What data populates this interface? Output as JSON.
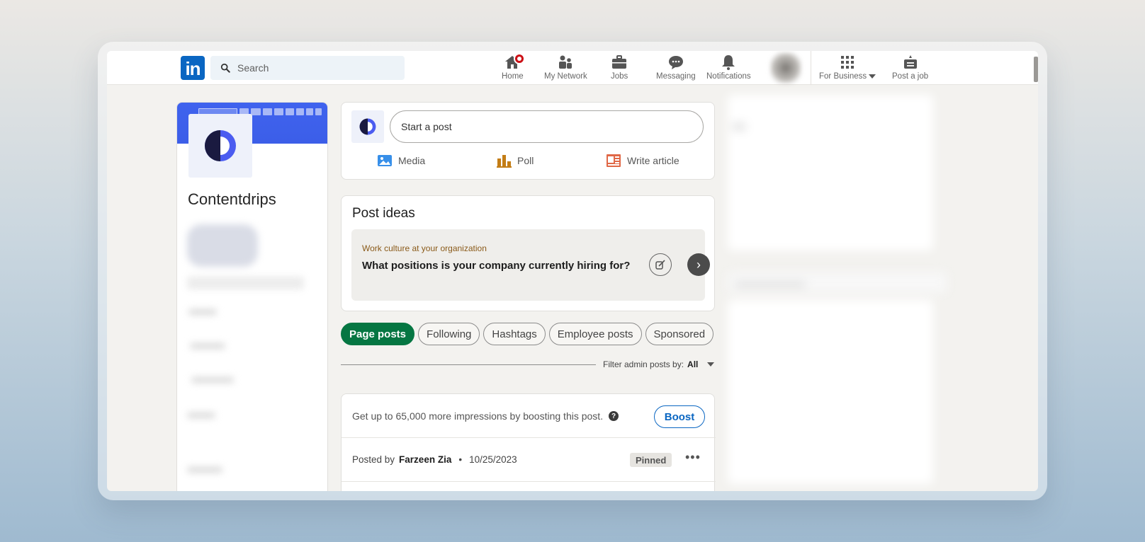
{
  "nav": {
    "search_placeholder": "Search",
    "items": [
      {
        "label": "Home",
        "icon": "home-icon"
      },
      {
        "label": "My Network",
        "icon": "network-icon"
      },
      {
        "label": "Jobs",
        "icon": "briefcase-icon"
      },
      {
        "label": "Messaging",
        "icon": "messaging-icon"
      },
      {
        "label": "Notifications",
        "icon": "bell-icon"
      }
    ],
    "for_business": "For Business",
    "post_job": "Post a job"
  },
  "company": {
    "name": "Contentdrips"
  },
  "composer": {
    "placeholder": "Start a post",
    "actions": {
      "media": "Media",
      "poll": "Poll",
      "article": "Write article"
    }
  },
  "ideas": {
    "title": "Post ideas",
    "tag": "Work culture at your organization",
    "question": "What positions is your company currently hiring for?"
  },
  "tabs": [
    "Page posts",
    "Following",
    "Hashtags",
    "Employee posts",
    "Sponsored"
  ],
  "filter": {
    "label": "Filter admin posts by:",
    "value": "All"
  },
  "post": {
    "boost_text": "Get up to 65,000 more impressions by boosting this post.",
    "boost_button": "Boost",
    "posted_by_label": "Posted by",
    "author": "Farzeen Zia",
    "bullet": "•",
    "date": "10/25/2023",
    "pinned": "Pinned",
    "more": "•••"
  },
  "colors": {
    "brand": "#0a66c2",
    "active_tab": "#057642",
    "cover": "#3f63ee",
    "badge": "#cc1016"
  }
}
